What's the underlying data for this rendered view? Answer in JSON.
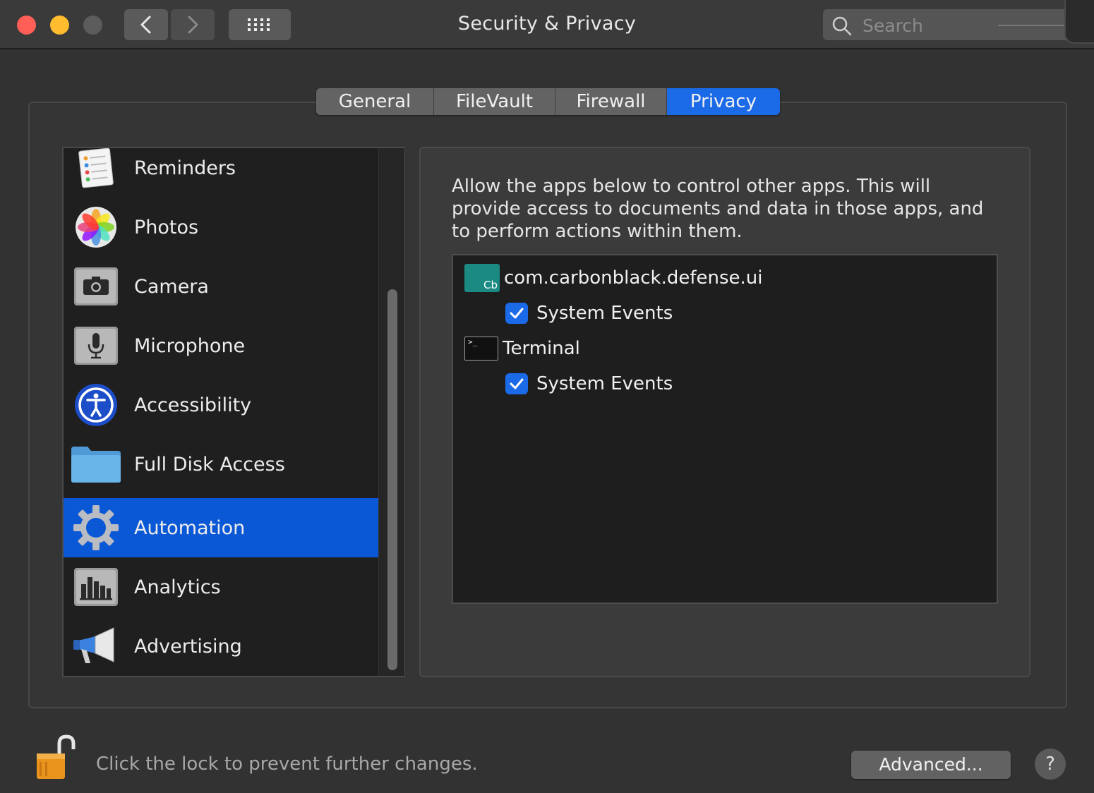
{
  "window": {
    "title": "Security & Privacy",
    "search_placeholder": "Search"
  },
  "tabs": [
    {
      "label": "General",
      "selected": false
    },
    {
      "label": "FileVault",
      "selected": false
    },
    {
      "label": "Firewall",
      "selected": false
    },
    {
      "label": "Privacy",
      "selected": true
    }
  ],
  "sidebar": {
    "items": [
      {
        "label": "Reminders",
        "icon": "reminders-icon"
      },
      {
        "label": "Photos",
        "icon": "photos-icon"
      },
      {
        "label": "Camera",
        "icon": "camera-icon"
      },
      {
        "label": "Microphone",
        "icon": "microphone-icon"
      },
      {
        "label": "Accessibility",
        "icon": "accessibility-icon"
      },
      {
        "label": "Full Disk Access",
        "icon": "folder-icon"
      },
      {
        "label": "Automation",
        "icon": "gear-icon",
        "selected": true
      },
      {
        "label": "Analytics",
        "icon": "analytics-icon"
      },
      {
        "label": "Advertising",
        "icon": "megaphone-icon"
      }
    ]
  },
  "panel": {
    "description": "Allow the apps below to control other apps. This will provide access to documents and data in those apps, and to perform actions within them.",
    "apps": [
      {
        "name": "com.carbonblack.defense.ui",
        "icon_text": "Cb",
        "targets": [
          {
            "label": "System Events",
            "checked": true
          }
        ]
      },
      {
        "name": "Terminal",
        "icon_text": ">_",
        "targets": [
          {
            "label": "System Events",
            "checked": true
          }
        ]
      }
    ]
  },
  "footer": {
    "lock_message": "Click the lock to prevent further changes.",
    "advanced_label": "Advanced...",
    "help_label": "?"
  },
  "colors": {
    "accent": "#1b6ae8",
    "selection": "#0a58d6",
    "background": "#323232"
  }
}
